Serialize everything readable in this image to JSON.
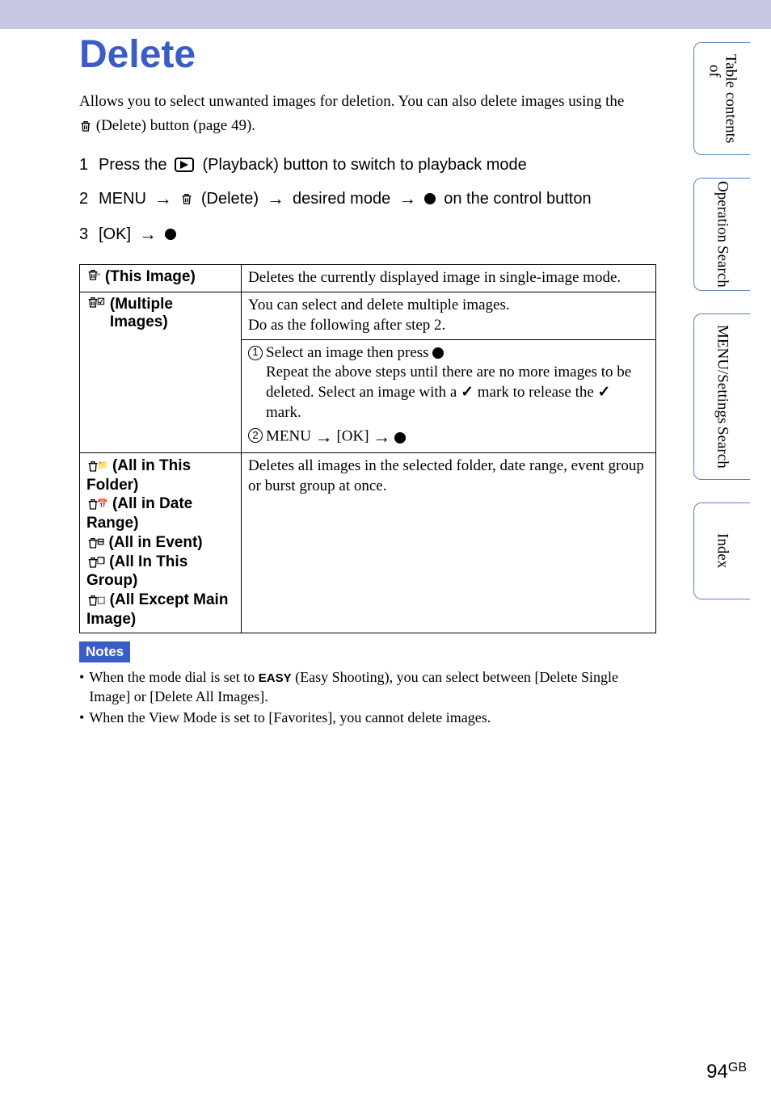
{
  "title": "Delete",
  "intro_line1": "Allows you to select unwanted images for deletion. You can also delete images using the",
  "intro_line2_suffix": " (Delete) button (page 49).",
  "steps": {
    "s1": {
      "n": "1",
      "pre": "Press the ",
      "post": " (Playback) button to switch to playback mode"
    },
    "s2": {
      "n": "2",
      "pre": "MENU ",
      "mid1": " (Delete) ",
      "mid2": " desired mode ",
      "post": " on the control button"
    },
    "s3": {
      "n": "3",
      "pre": "[OK] "
    }
  },
  "table": {
    "r1": {
      "label": " (This Image)",
      "desc": "Deletes the currently displayed image in single-image mode."
    },
    "r2": {
      "label": " (Multiple Images)",
      "desc_l1": "You can select and delete multiple images.",
      "desc_l2": "Do as the following after step 2."
    },
    "r2s1": {
      "l1": "Select an image then press ",
      "l2": "Repeat the above steps until there are no more images to be deleted. Select an image with a ",
      "l2b": " mark to release the ",
      "l2c": " mark."
    },
    "r2s2": {
      "pre": "MENU ",
      "mid": " [OK] "
    },
    "r3": {
      "labels": [
        " (All in This Folder)",
        " (All in Date Range)",
        " (All in Event)",
        " (All In This Group)",
        " (All Except Main Image)"
      ],
      "desc": "Deletes all images in the selected folder, date range, event group or burst group at once."
    }
  },
  "notes": {
    "head": "Notes",
    "n1a": "When the mode dial is set to ",
    "n1_easy": "EASY",
    "n1b": " (Easy Shooting), you can select between [Delete Single Image] or [Delete All Images].",
    "n2": "When the View Mode is set to [Favorites], you cannot delete images."
  },
  "tabs": {
    "t1a": "Table of",
    "t1b": "contents",
    "t2a": "Operation",
    "t2b": "Search",
    "t3a": "MENU/Settings",
    "t3b": "Search",
    "t4": "Index"
  },
  "page": {
    "num": "94",
    "suf": "GB"
  }
}
